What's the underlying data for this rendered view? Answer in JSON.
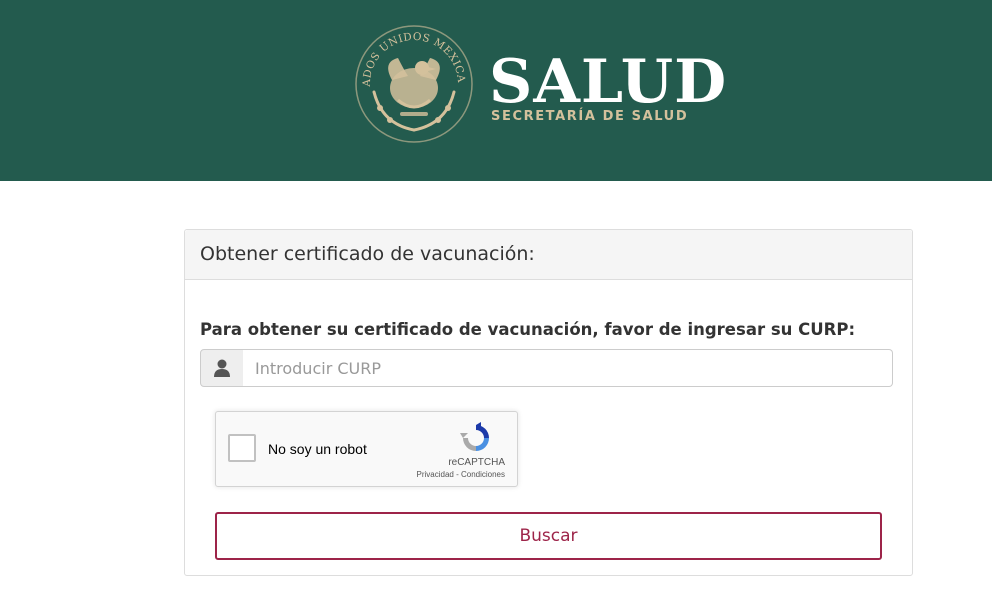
{
  "header": {
    "seal_text": "ESTADOS UNIDOS MEXICANOS",
    "brand_title": "SALUD",
    "brand_subtitle": "SECRETARÍA DE SALUD"
  },
  "panel": {
    "title": "Obtener certificado de vacunación:"
  },
  "form": {
    "label": "Para obtener su certificado de vacunación, favor de ingresar su CURP:",
    "curp_value": "",
    "curp_placeholder": "Introducir CURP",
    "user_icon": "user-icon"
  },
  "recaptcha": {
    "label": "No soy un robot",
    "brand": "reCAPTCHA",
    "privacy": "Privacidad",
    "separator": " - ",
    "terms": "Condiciones"
  },
  "actions": {
    "search_label": "Buscar"
  },
  "colors": {
    "header_green": "#235b4e",
    "gold": "#d4c19c",
    "accent_maroon": "#9d2449"
  }
}
